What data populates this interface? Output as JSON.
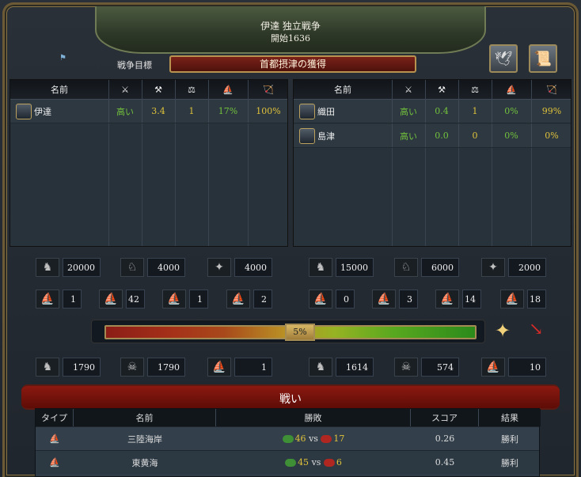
{
  "window": {
    "title": "伊達 独立戦争",
    "subtitle": "開始1636",
    "goal_label": "戦争目標",
    "goal": "首都摂津の獲得"
  },
  "left_table": {
    "headers": [
      "名前",
      "⚔",
      "⚒",
      "⚖",
      "⛵",
      "🏹"
    ],
    "rows": [
      {
        "name": "伊達",
        "v1": "高い",
        "v2": "3.4",
        "v3": "1",
        "v4": "17%",
        "v5": "100%"
      }
    ]
  },
  "right_table": {
    "headers": [
      "名前",
      "⚔",
      "⚒",
      "⚖",
      "⛵",
      "🏹"
    ],
    "rows": [
      {
        "name": "織田",
        "v1": "高い",
        "v2": "0.4",
        "v3": "1",
        "v4": "0%",
        "v5": "99%"
      },
      {
        "name": "島津",
        "v1": "高い",
        "v2": "0.0",
        "v3": "0",
        "v4": "0%",
        "v5": "0%"
      }
    ]
  },
  "left_forces": {
    "infantry": "20000",
    "cavalry": "4000",
    "artillery": "4000",
    "heavy_ships": "1",
    "light_ships": "42",
    "galleys": "1",
    "transports": "2"
  },
  "right_forces": {
    "infantry": "15000",
    "cavalry": "6000",
    "artillery": "2000",
    "heavy_ships": "0",
    "light_ships": "3",
    "galleys": "14",
    "transports": "18"
  },
  "war_score": {
    "value": 0.05,
    "label": "5%"
  },
  "left_losses": {
    "land": "1790",
    "attrition": "1790",
    "naval": "1"
  },
  "right_losses": {
    "land": "1614",
    "attrition": "574",
    "naval": "10"
  },
  "battles": {
    "title": "戦い",
    "headers": [
      "タイプ",
      "名前",
      "勝敗",
      "スコア",
      "結果"
    ],
    "rows": [
      {
        "name": "三陸海岸",
        "left": "46",
        "vs": "vs",
        "right": "17",
        "score": "0.26",
        "result": "勝利"
      },
      {
        "name": "東黄海",
        "left": "45",
        "vs": "vs",
        "right": "6",
        "score": "0.45",
        "result": "勝利"
      }
    ]
  },
  "colors": {
    "accent": "#b89350",
    "win": "#73c23c",
    "loss": "#d42b28"
  }
}
